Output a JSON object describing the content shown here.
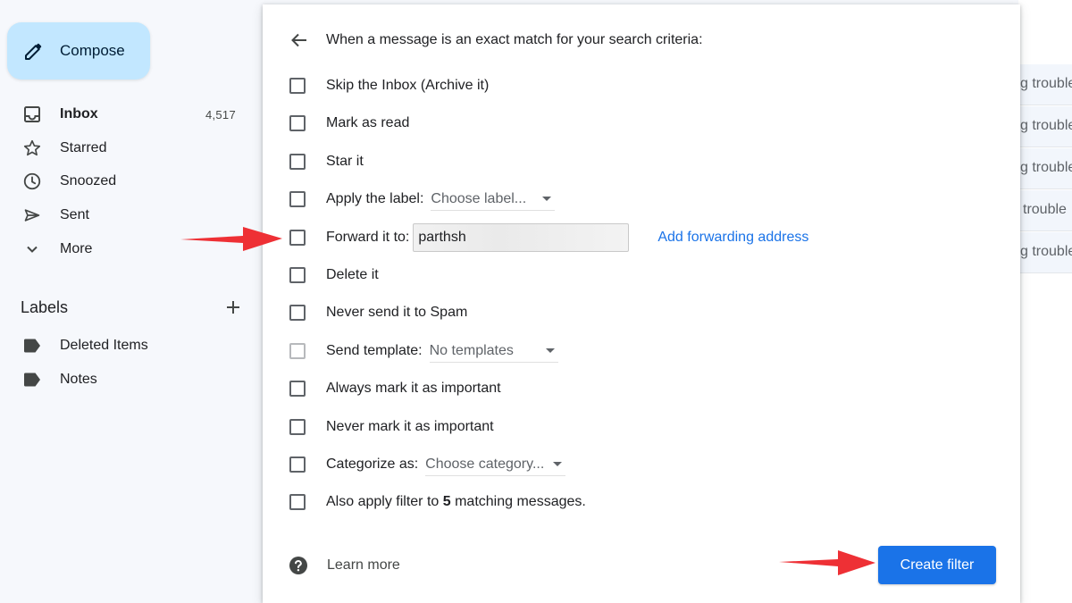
{
  "compose": {
    "label": "Compose",
    "icon": "pencil-icon"
  },
  "nav": [
    {
      "id": "inbox",
      "label": "Inbox",
      "count": "4,517",
      "icon": "inbox-icon",
      "bold": true
    },
    {
      "id": "starred",
      "label": "Starred",
      "icon": "star-icon"
    },
    {
      "id": "snoozed",
      "label": "Snoozed",
      "icon": "clock-icon"
    },
    {
      "id": "sent",
      "label": "Sent",
      "icon": "send-icon"
    },
    {
      "id": "more",
      "label": "More",
      "icon": "chevron-down-icon"
    }
  ],
  "labels": {
    "title": "Labels",
    "items": [
      {
        "label": "Deleted Items",
        "icon": "label-icon"
      },
      {
        "label": "Notes",
        "icon": "label-icon"
      }
    ]
  },
  "mail_list": {
    "rows": [
      "g trouble",
      "g trouble",
      "g trouble",
      "trouble",
      "g trouble"
    ]
  },
  "dialog": {
    "title": "When a message is an exact match for your search criteria:",
    "options": {
      "skip_inbox": "Skip the Inbox (Archive it)",
      "mark_read": "Mark as read",
      "star": "Star it",
      "apply_label": "Apply the label:",
      "apply_label_select": "Choose label...",
      "forward": "Forward it to:",
      "forward_value": "parthsh",
      "add_forwarding": "Add forwarding address",
      "delete": "Delete it",
      "never_spam": "Never send it to Spam",
      "send_template": "Send template:",
      "send_template_select": "No templates",
      "always_important": "Always mark it as important",
      "never_important": "Never mark it as important",
      "categorize": "Categorize as:",
      "categorize_select": "Choose category...",
      "also_apply_prefix": "Also apply filter to",
      "also_apply_count": "5",
      "also_apply_suffix": "matching messages."
    },
    "learn_more": "Learn more",
    "create_button": "Create filter"
  },
  "colors": {
    "accent": "#1a73e8",
    "compose_bg": "#c2e7ff",
    "annotation_arrow": "#ee3035"
  }
}
